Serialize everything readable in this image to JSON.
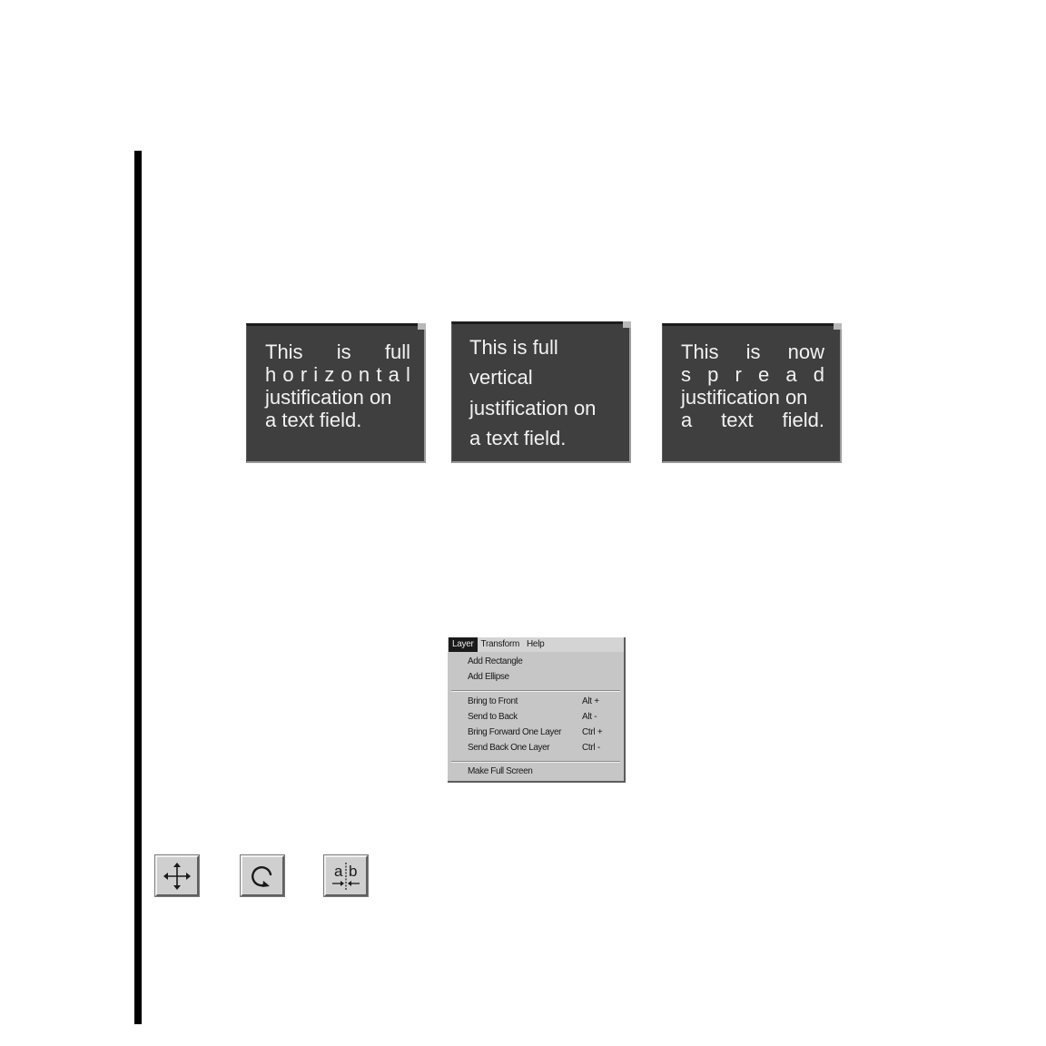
{
  "text_fields": {
    "horizontal": {
      "line1": [
        "This",
        "is",
        "full"
      ],
      "line2": "horizontal",
      "line3": "justification on",
      "line4": "a text field."
    },
    "vertical": {
      "line1": "This is full",
      "line2": "vertical",
      "line3": "justification on",
      "line4": "a text field."
    },
    "spread": {
      "line1": [
        "This",
        "is",
        "now"
      ],
      "line2": "spread",
      "line3": "justification on",
      "line4": [
        "a",
        "text",
        "field."
      ]
    }
  },
  "menu": {
    "bar": {
      "layer": "Layer",
      "transform": "Transform",
      "help": "Help"
    },
    "items": {
      "add_rectangle": "Add Rectangle",
      "add_ellipse": "Add Ellipse",
      "bring_to_front": "Bring to Front",
      "bring_to_front_sc": "Alt +",
      "send_to_back": "Send to Back",
      "send_to_back_sc": "Alt -",
      "bring_forward": "Bring Forward One Layer",
      "bring_forward_sc": "Ctrl +",
      "send_back": "Send Back One Layer",
      "send_back_sc": "Ctrl -",
      "make_full_screen": "Make Full Screen"
    }
  },
  "tools": {
    "move_icon": "move-arrows-icon",
    "rotate_icon": "rotate-icon",
    "justify_icon": "text-justify-icon",
    "justify_a": "a",
    "justify_b": "b"
  }
}
